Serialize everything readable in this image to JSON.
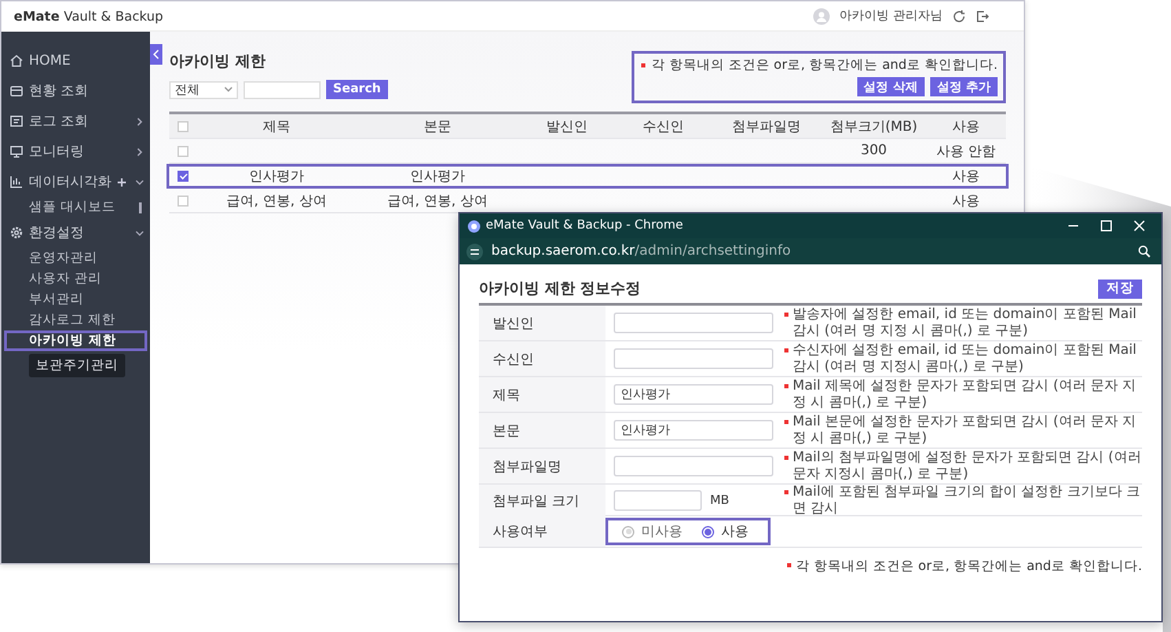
{
  "app": {
    "logo": "**eMate** Vault & Backup",
    "user": "아카이빙 관리자님"
  },
  "sidebar": {
    "items": [
      {
        "label": "HOME",
        "selected": false
      },
      {
        "label": "현황 조회",
        "selected": false
      },
      {
        "label": "로그 조회",
        "selected": false,
        "expanded": false
      },
      {
        "label": "모니터링",
        "selected": false,
        "expanded": false
      },
      {
        "label": "데이터시각화",
        "selected": false,
        "expanded": true,
        "add_button": true,
        "children": [
          {
            "label": "샘플 대시보드",
            "selected": false,
            "pinned": true
          }
        ]
      },
      {
        "label": "환경설정",
        "selected": false,
        "expanded": true,
        "children": [
          {
            "label": "운영자관리",
            "selected": false
          },
          {
            "label": "사용자 관리",
            "selected": false
          },
          {
            "label": "부서관리",
            "selected": false
          },
          {
            "label": "감사로그 제한",
            "selected": false
          },
          {
            "label": "아카이빙 제한",
            "selected": true
          }
        ]
      }
    ],
    "tooltip": "보관주기관리"
  },
  "page": {
    "title": "아카이빙 제한",
    "filter": {
      "value": "전체"
    },
    "search": {
      "button": "Search"
    },
    "note": "각 항목내의 조건은 or로, 항목간에는 and로 확인합니다.",
    "buttons": [
      "설정 삭제",
      "설정 추가"
    ]
  },
  "table": {
    "select_all": {
      "checked": false
    },
    "columns": [
      "제목",
      "본문",
      "발신인",
      "수신인",
      "첨부파일명",
      "첨부크기(MB)",
      "사용"
    ],
    "rows": [
      {
        "checked": false,
        "cells": [
          "",
          "",
          "",
          "",
          "",
          "300",
          "사용 안함"
        ]
      },
      {
        "checked": true,
        "cells": [
          "인사평가",
          "인사평가",
          "",
          "",
          "",
          "",
          "사용"
        ]
      },
      {
        "checked": false,
        "cells": [
          "급여, 연봉, 상여",
          "급여, 연봉, 상여",
          "",
          "",
          "",
          "",
          "사용"
        ]
      }
    ]
  },
  "popup": {
    "title": "eMate Vault & Backup - Chrome",
    "url_host": "backup.saerom.co.kr",
    "url_path": "/admin/archsettinginfo",
    "heading": "아카이빙 제한 정보수정",
    "save": "저장",
    "fields": [
      {
        "kind": "text",
        "label": "발신인",
        "hint": "발송자에 설정한 email, id 또는 domain이 포함된 Mail 감시 (여러 명 지정 시 콤마(,) 로 구분)"
      },
      {
        "kind": "text",
        "label": "수신인",
        "hint": "수신자에 설정한 email, id 또는 domain이 포함된 Mail 감시 (여러 명 지정시 콤마(,) 로 구분)"
      },
      {
        "kind": "text",
        "label": "제목",
        "value": "인사평가",
        "hint": "Mail 제목에 설정한 문자가 포함되면 감시 (여러 문자 지정 시 콤마(,) 로 구분)"
      },
      {
        "kind": "text",
        "label": "본문",
        "value": "인사평가",
        "hint": "Mail 본문에 설정한 문자가 포함되면 감시 (여러 문자 지정 시 콤마(,) 로 구분)"
      },
      {
        "kind": "text",
        "label": "첨부파일명",
        "hint": "Mail의 첨부파일명에 설정한 문자가 포함되면 감시 (여러문자 지정시 콤마(,) 로 구분)"
      },
      {
        "kind": "size",
        "label": "첨부파일 크기",
        "unit": "MB",
        "hint": "Mail에 포함된 첨부파일 크기의 합이 설정한 크기보다 크면 감시"
      },
      {
        "kind": "radio",
        "label": "사용여부",
        "options": [
          {
            "label": "미사용",
            "selected": false
          },
          {
            "label": "사용",
            "selected": true
          }
        ]
      }
    ],
    "footer_note": "각 항목내의 조건은 or로, 항목간에는 and로 확인합니다."
  }
}
